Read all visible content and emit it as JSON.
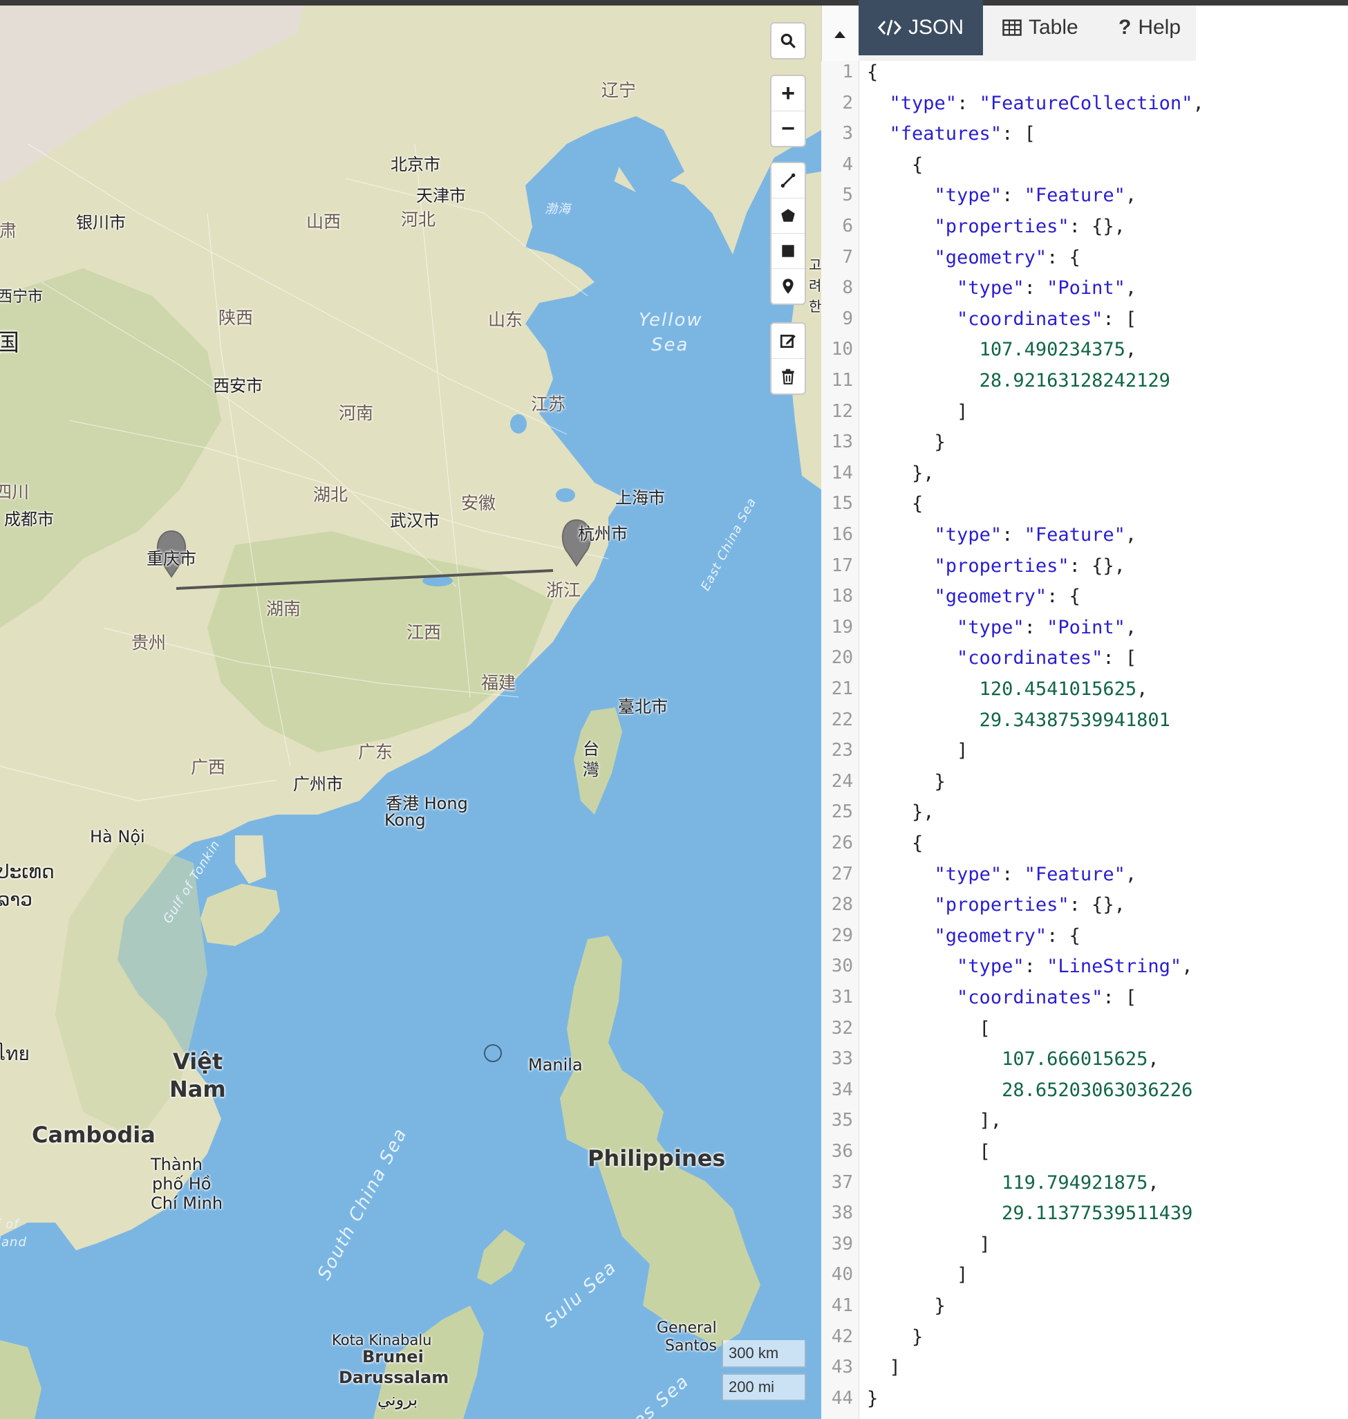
{
  "map": {
    "labels": {
      "liaoning": "辽宁",
      "beijing": "北京市",
      "tianjin": "天津市",
      "shanxi": "山西",
      "hebei": "河北",
      "yinchuan": "银川市",
      "gansu": "甘肃",
      "xining": "西宁市",
      "guo": "国",
      "shaanxi": "陕西",
      "shandong": "山东",
      "bohai": "渤海",
      "yellow_sea_1": "Yellow",
      "yellow_sea_2": "Sea",
      "xian": "西安市",
      "henan": "河南",
      "jiangsu": "江苏",
      "sichuan": "四川",
      "chengdu": "成都市",
      "hubei": "湖北",
      "anhui": "安徽",
      "shanghai": "上海市",
      "wuhan": "武汉市",
      "chongqing": "重庆市",
      "hangzhou": "杭州市",
      "hunan": "湖南",
      "zhejiang": "浙江",
      "guizhou": "贵州",
      "jiangxi": "江西",
      "east_china_sea": "East China Sea",
      "fujian": "福建",
      "taipei": "臺北市",
      "taiwan": "台灣",
      "guangxi": "广西",
      "guangdong": "广东",
      "guangzhou": "广州市",
      "hong_kong_1": "香港 Hong",
      "hong_kong_2": "Kong",
      "hanoi": "Hà Nội",
      "lao_1": "ປະເທດ",
      "lao_2": "ລາວ",
      "gulf_of_tonkin": "Gulf of Tonkin",
      "thai": "ไทย",
      "vietnam_1": "Việt",
      "vietnam_2": "Nam",
      "manila": "Manila",
      "cambodia": "Cambodia",
      "philippines": "Philippines",
      "hcmc_1": "Thành",
      "hcmc_2": "phố Hồ",
      "hcmc_3": "Chí Minh",
      "gulf_thailand_1": "f of",
      "gulf_thailand_2": "land",
      "south_china_sea": "South China Sea",
      "sulu_sea": "Sulu Sea",
      "general_santos_1": "General",
      "general_santos_2": "Santos",
      "kota_kinabalu": "Kota Kinabalu",
      "brunei_1": "Brunei",
      "brunei_2": "Darussalam",
      "brunei_ar": "بروني",
      "celebes_sea": "es Sea",
      "korea_edge": "고려 한"
    },
    "controls": {
      "search": "search-icon",
      "zoom_in": "+",
      "zoom_out": "−",
      "draw_line": "line-icon",
      "draw_polygon": "polygon-icon",
      "draw_rectangle": "rectangle-icon",
      "draw_marker": "marker-icon",
      "edit": "edit-icon",
      "delete": "trash-icon"
    },
    "scale": {
      "km": "300 km",
      "mi": "200 mi"
    }
  },
  "tabs": [
    {
      "label": "JSON",
      "icon": "code-icon",
      "active": true
    },
    {
      "label": "Table",
      "icon": "table-icon",
      "active": false
    },
    {
      "label": "Help",
      "icon": "question-icon",
      "active": false
    }
  ],
  "editor": {
    "line_numbers": [
      "1",
      "2",
      "3",
      "4",
      "5",
      "6",
      "7",
      "8",
      "9",
      "10",
      "11",
      "12",
      "13",
      "14",
      "15",
      "16",
      "17",
      "18",
      "19",
      "20",
      "21",
      "22",
      "23",
      "24",
      "25",
      "26",
      "27",
      "28",
      "29",
      "30",
      "31",
      "32",
      "33",
      "34",
      "35",
      "36",
      "37",
      "38",
      "39",
      "40",
      "41",
      "42",
      "43",
      "44"
    ],
    "lines": [
      "{",
      "  \"type\": \"FeatureCollection\",",
      "  \"features\": [",
      "    {",
      "      \"type\": \"Feature\",",
      "      \"properties\": {},",
      "      \"geometry\": {",
      "        \"type\": \"Point\",",
      "        \"coordinates\": [",
      "          107.490234375,",
      "          28.92163128242129",
      "        ]",
      "      }",
      "    },",
      "    {",
      "      \"type\": \"Feature\",",
      "      \"properties\": {},",
      "      \"geometry\": {",
      "        \"type\": \"Point\",",
      "        \"coordinates\": [",
      "          120.4541015625,",
      "          29.34387539941801",
      "        ]",
      "      }",
      "    },",
      "    {",
      "      \"type\": \"Feature\",",
      "      \"properties\": {},",
      "      \"geometry\": {",
      "        \"type\": \"LineString\",",
      "        \"coordinates\": [",
      "          [",
      "            107.666015625,",
      "            28.65203063036226",
      "          ],",
      "          [",
      "            119.794921875,",
      "            29.11377539511439",
      "          ]",
      "        ]",
      "      }",
      "    }",
      "  ]",
      "}"
    ]
  },
  "colors": {
    "water": "#7bb6e3",
    "land": "#e3e1c2",
    "tab_active": "#3c4d61",
    "json_key": "#2a1ed0",
    "json_number": "#116644",
    "marker": "#7f7f7f"
  }
}
